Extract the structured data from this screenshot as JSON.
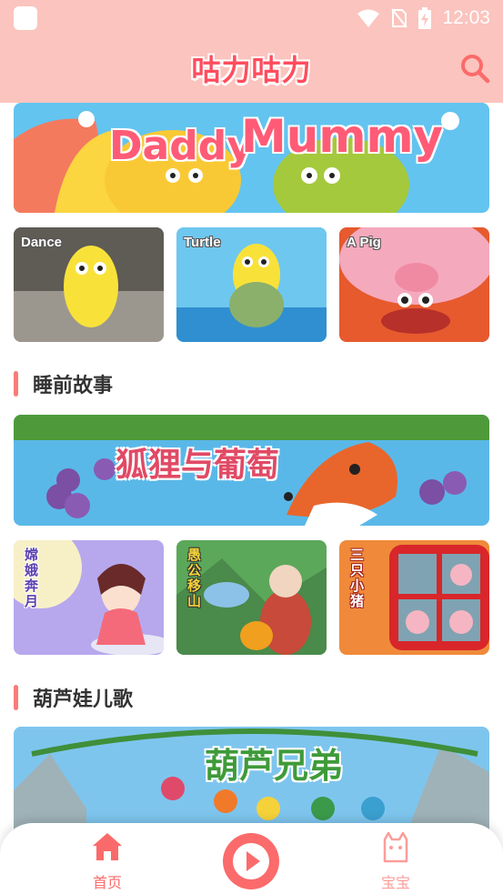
{
  "status_bar": {
    "time": "12:03",
    "icons": [
      "app-icon",
      "wifi-icon",
      "no-sim-icon",
      "battery-charging-icon"
    ]
  },
  "app_bar": {
    "logo_text": "咕力咕力",
    "search_icon": "search-icon"
  },
  "colors": {
    "header_bg": "#fbc4be",
    "accent": "#fb6b6b",
    "section_bar": "#fb7b79",
    "title_text": "#333333"
  },
  "top_banner": {
    "title_part1": "Daddy",
    "title_part2": "Mummy"
  },
  "top_row": [
    {
      "label": "Dance"
    },
    {
      "label": "Turtle"
    },
    {
      "label": "A Pig"
    }
  ],
  "section_bedtime": {
    "title": "睡前故事",
    "banner_title": "狐狸与葡萄",
    "thumbnails": [
      {
        "label": "嫦娥奔月"
      },
      {
        "label": "愚公移山"
      },
      {
        "label": "三只小猪"
      }
    ]
  },
  "section_calabash": {
    "title": "葫芦娃儿歌",
    "banner_title": "葫芦兄弟"
  },
  "bottom_nav": {
    "home_label": "首页",
    "play_icon": "play-icon",
    "baby_label": "宝宝"
  }
}
